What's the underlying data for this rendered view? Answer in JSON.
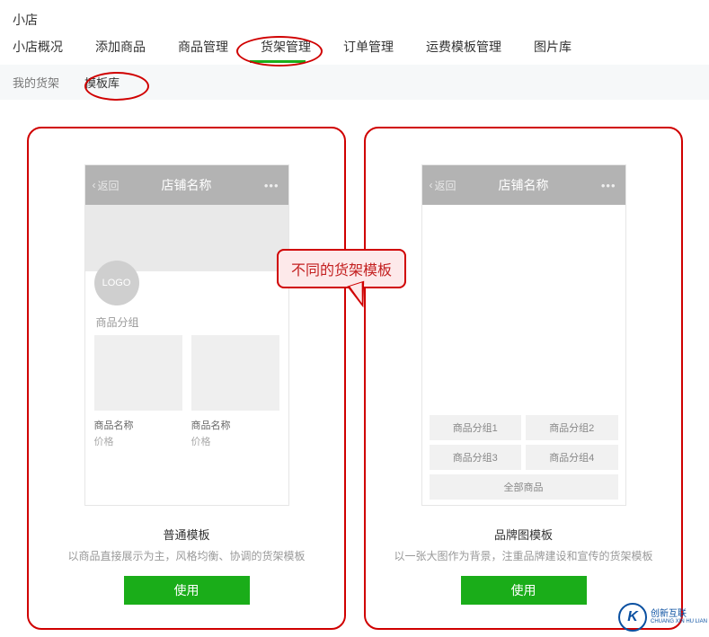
{
  "page_title": "小店",
  "main_tabs": [
    "小店概况",
    "添加商品",
    "商品管理",
    "货架管理",
    "订单管理",
    "运费模板管理",
    "图片库"
  ],
  "main_tab_active_index": 3,
  "sub_tabs": {
    "items": [
      "我的货架",
      "模板库"
    ],
    "active_index": 1
  },
  "callout_text": "不同的货架模板",
  "phone_header": {
    "back": "返回",
    "title": "店铺名称",
    "more": "•••"
  },
  "template_a": {
    "logo_text": "LOGO",
    "group_label": "商品分组",
    "product1": {
      "name": "商品名称",
      "price": "价格"
    },
    "product2": {
      "name": "商品名称",
      "price": "价格"
    },
    "title": "普通模板",
    "desc": "以商品直接展示为主，风格均衡、协调的货架模板",
    "use_label": "使用"
  },
  "template_b": {
    "btns": [
      "商品分组1",
      "商品分组2",
      "商品分组3",
      "商品分组4"
    ],
    "btn_all": "全部商品",
    "title": "品牌图模板",
    "desc": "以一张大图作为背景，注重品牌建设和宣传的货架模板",
    "use_label": "使用"
  },
  "watermark": {
    "logo": "K",
    "line1": "创新互联",
    "line2": "CHUANG XIN HU LIAN"
  }
}
